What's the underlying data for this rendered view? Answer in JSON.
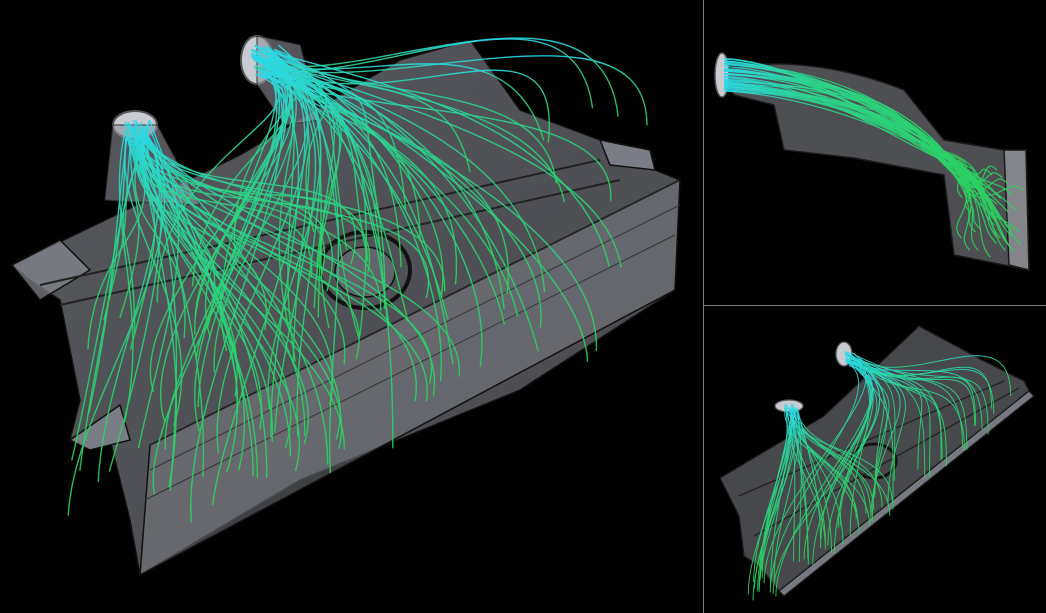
{
  "viewport": {
    "layout": "three-view",
    "views": [
      {
        "id": "main",
        "projection": "perspective-front",
        "show_streamlines": true
      },
      {
        "id": "side",
        "projection": "side",
        "show_streamlines": true
      },
      {
        "id": "iso",
        "projection": "isometric",
        "show_streamlines": true
      }
    ]
  },
  "colors": {
    "background": "#000000",
    "housing_fill": "#8c8f96",
    "housing_edge": "#1a1a1a",
    "streamline_inlet": "#29d4e6",
    "streamline_outlet": "#29d35a",
    "inlet_collar": "#c8ccd2",
    "divider": "#7a7a7a"
  },
  "icons": [
    "airflow-streamlines",
    "duct-inlet"
  ]
}
